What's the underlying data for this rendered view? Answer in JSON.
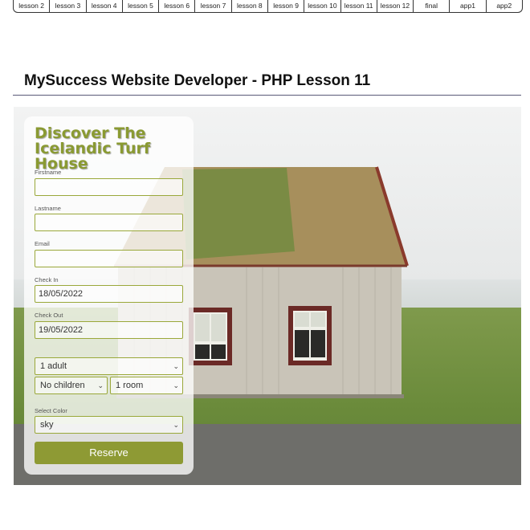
{
  "nav": {
    "items": [
      "lesson 2",
      "lesson 3",
      "lesson 4",
      "lesson 5",
      "lesson 6",
      "lesson 7",
      "lesson 8",
      "lesson 9",
      "lesson 10",
      "lesson 11",
      "lesson 12",
      "final",
      "app1",
      "app2"
    ]
  },
  "page": {
    "title": "MySuccess Website Developer - PHP Lesson 11"
  },
  "form": {
    "heading_line1": "Discover The",
    "heading_line2": "Icelandic Turf House",
    "firstname_label": "Firstname",
    "firstname_value": "",
    "lastname_label": "Lastname",
    "lastname_value": "",
    "email_label": "Email",
    "email_value": "",
    "checkin_label": "Check In",
    "checkin_value": "18/05/2022",
    "checkout_label": "Check Out",
    "checkout_value": "19/05/2022",
    "adults_value": "1 adult",
    "children_value": "No children",
    "rooms_value": "1 room",
    "color_label": "Select Color",
    "color_value": "sky",
    "reserve_label": "Reserve"
  },
  "colors": {
    "accent": "#8e9a34",
    "heading": "#8a9a32"
  }
}
